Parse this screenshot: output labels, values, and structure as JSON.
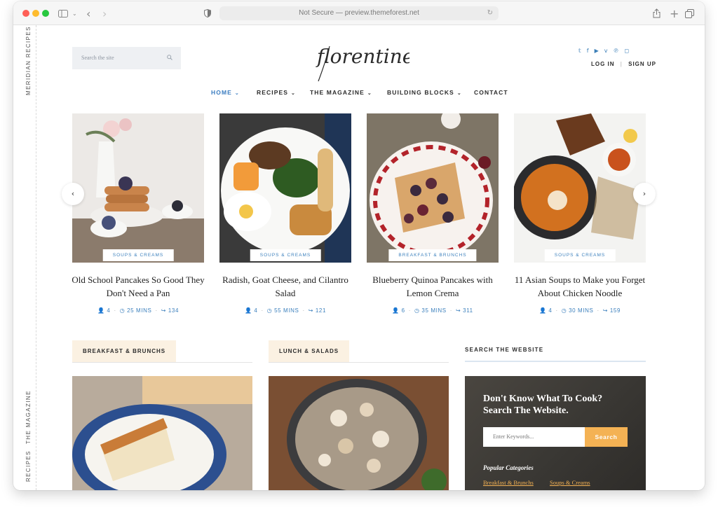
{
  "browser": {
    "url_text": "Not Secure — preview.themeforest.net"
  },
  "side_rail": {
    "top_label": "MERIDIAN RECIPES",
    "middle_label": "THE MAGAZINE",
    "bottom_label": "RECIPES"
  },
  "header": {
    "search_placeholder": "Search the site",
    "logo_text": "florentine",
    "social_icons": [
      "twitter-icon",
      "facebook-icon",
      "youtube-icon",
      "vimeo-icon",
      "pinterest-icon",
      "instagram-icon"
    ],
    "login_label": "LOG IN",
    "separator": "|",
    "signup_label": "SIGN UP"
  },
  "nav": [
    {
      "label": "HOME",
      "active": true,
      "dropdown": true
    },
    {
      "label": "RECIPES",
      "active": false,
      "dropdown": true
    },
    {
      "label": "THE MAGAZINE",
      "active": false,
      "dropdown": true
    },
    {
      "label": "BUILDING BLOCKS",
      "active": false,
      "dropdown": true
    },
    {
      "label": "CONTACT",
      "active": false,
      "dropdown": false
    }
  ],
  "carousel": {
    "cards": [
      {
        "category": "SOUPS & CREAMS",
        "title": "Old School Pancakes So Good They Don't Need a Pan",
        "servings": "4",
        "time": "25 MINS",
        "shares": "134"
      },
      {
        "category": "SOUPS & CREAMS",
        "title": "Radish, Goat Cheese, and Cilantro Salad",
        "servings": "4",
        "time": "55 MINS",
        "shares": "121"
      },
      {
        "category": "BREAKFAST & BRUNCHS",
        "title": "Blueberry Quinoa Pancakes with Lemon Crema",
        "servings": "6",
        "time": "35 MINS",
        "shares": "311"
      },
      {
        "category": "SOUPS & CREAMS",
        "title": "11 Asian Soups to Make you Forget About Chicken Noodle",
        "servings": "4",
        "time": "30 MINS",
        "shares": "159"
      }
    ]
  },
  "sections": {
    "breakfast_label": "BREAKFAST & BRUNCHS",
    "lunch_label": "LUNCH & SALADS",
    "search_label": "SEARCH THE WEBSITE"
  },
  "search_widget": {
    "title": "Don't Know What To Cook? Search The Website.",
    "input_placeholder": "Enter Keywords...",
    "button_label": "Search",
    "popular_label": "Popular Categories",
    "categories": [
      "Breakfast & Brunchs",
      "Soups & Creams"
    ]
  },
  "colors": {
    "accent_blue": "#3a7cc0",
    "section_bg": "#fbf1e2",
    "search_button": "#f4b254"
  }
}
